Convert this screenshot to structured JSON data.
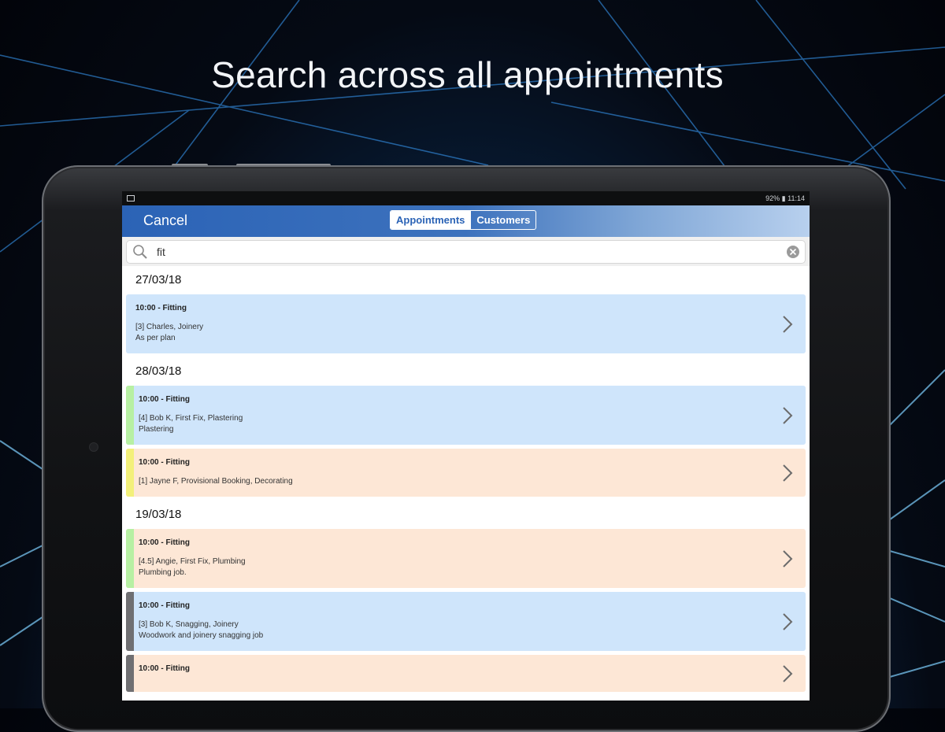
{
  "headline": "Search across all appointments",
  "colors": {
    "nav_blue": "#2b63b6",
    "appointment_blue": "#cfe5fb",
    "appointment_peach": "#fde7d6",
    "stripe_green": "#b7f0a3",
    "stripe_yellow": "#f3f07a",
    "stripe_grey": "#6f6f72"
  },
  "statusbar": {
    "right_text": "92% ▮ 11:14"
  },
  "nav": {
    "cancel_label": "Cancel",
    "tabs": [
      {
        "label": "Appointments",
        "active": true
      },
      {
        "label": "Customers",
        "active": false
      }
    ]
  },
  "search": {
    "value": "fit",
    "icon": "search-icon",
    "clear_icon": "clear-icon"
  },
  "groups": [
    {
      "date": "27/03/18",
      "items": [
        {
          "title": "10:00 - Fitting",
          "line1": "[3] Charles, Joinery",
          "line2": "As per plan",
          "color": "blue",
          "stripe": "none"
        }
      ]
    },
    {
      "date": "28/03/18",
      "items": [
        {
          "title": "10:00 - Fitting",
          "line1": "[4] Bob K, First Fix, Plastering",
          "line2": "Plastering",
          "color": "blue",
          "stripe": "green"
        },
        {
          "title": "10:00 - Fitting",
          "line1": "[1] Jayne F, Provisional Booking, Decorating",
          "line2": "",
          "color": "peach",
          "stripe": "yellow"
        }
      ]
    },
    {
      "date": "19/03/18",
      "items": [
        {
          "title": "10:00 - Fitting",
          "line1": "[4.5] Angie, First Fix, Plumbing",
          "line2": "Plumbing job.",
          "color": "peach",
          "stripe": "green"
        },
        {
          "title": "10:00 - Fitting",
          "line1": "[3] Bob K, Snagging, Joinery",
          "line2": "Woodwork and joinery snagging job",
          "color": "blue",
          "stripe": "grey"
        },
        {
          "title": "10:00 - Fitting",
          "line1": "",
          "line2": "",
          "color": "peach",
          "stripe": "grey"
        }
      ]
    }
  ]
}
